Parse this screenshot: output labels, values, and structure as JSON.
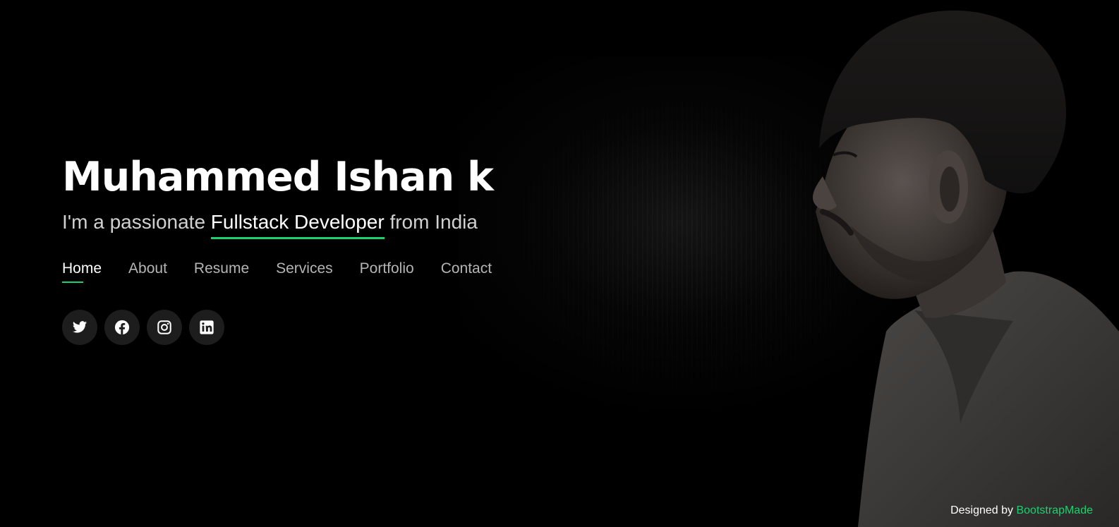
{
  "hero": {
    "name": "Muhammed Ishan k",
    "tagline_prefix": "I'm a passionate ",
    "tagline_typed": "Fullstack Developer",
    "tagline_suffix": " from India"
  },
  "nav": {
    "items": [
      {
        "label": "Home",
        "active": true
      },
      {
        "label": "About"
      },
      {
        "label": "Resume"
      },
      {
        "label": "Services"
      },
      {
        "label": "Portfolio"
      },
      {
        "label": "Contact"
      }
    ]
  },
  "social": {
    "icons": [
      "twitter-icon",
      "facebook-icon",
      "instagram-icon",
      "linkedin-icon"
    ]
  },
  "footer": {
    "credits_prefix": "Designed by ",
    "credits_link": "BootstrapMade"
  },
  "colors": {
    "accent": "#18d26e",
    "background": "#000000",
    "social_button_bg": "#1d1d1d"
  }
}
